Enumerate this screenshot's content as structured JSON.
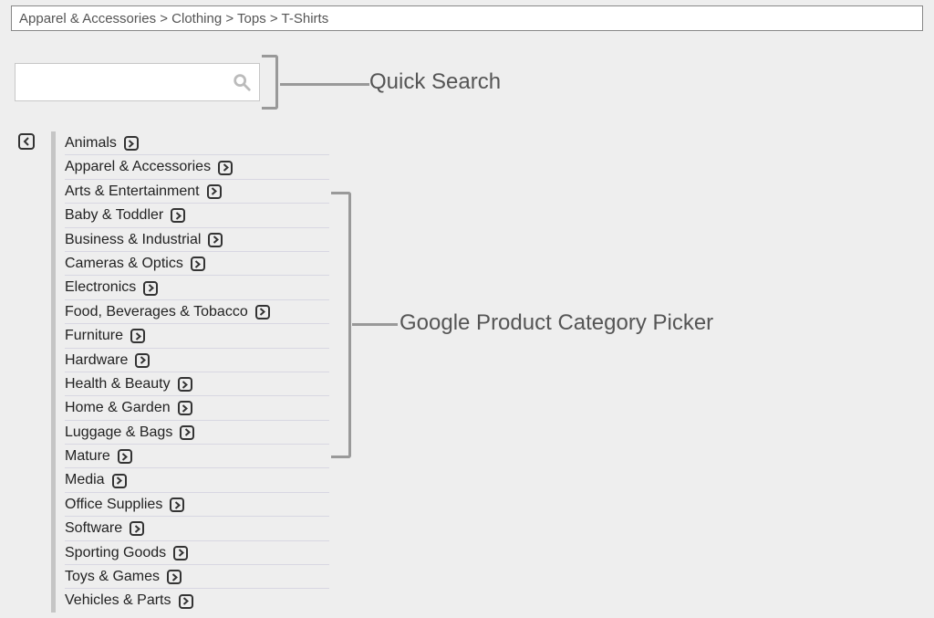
{
  "breadcrumb": {
    "value": "Apparel & Accessories > Clothing > Tops > T-Shirts"
  },
  "labels": {
    "quick_search": "Quick Search",
    "picker": "Google Product Category Picker"
  },
  "categories": [
    "Animals",
    "Apparel & Accessories",
    "Arts & Entertainment",
    "Baby & Toddler",
    "Business & Industrial",
    "Cameras & Optics",
    "Electronics",
    "Food, Beverages & Tobacco",
    "Furniture",
    "Hardware",
    "Health & Beauty",
    "Home & Garden",
    "Luggage & Bags",
    "Mature",
    "Media",
    "Office Supplies",
    "Software",
    "Sporting Goods",
    "Toys & Games",
    "Vehicles & Parts"
  ]
}
